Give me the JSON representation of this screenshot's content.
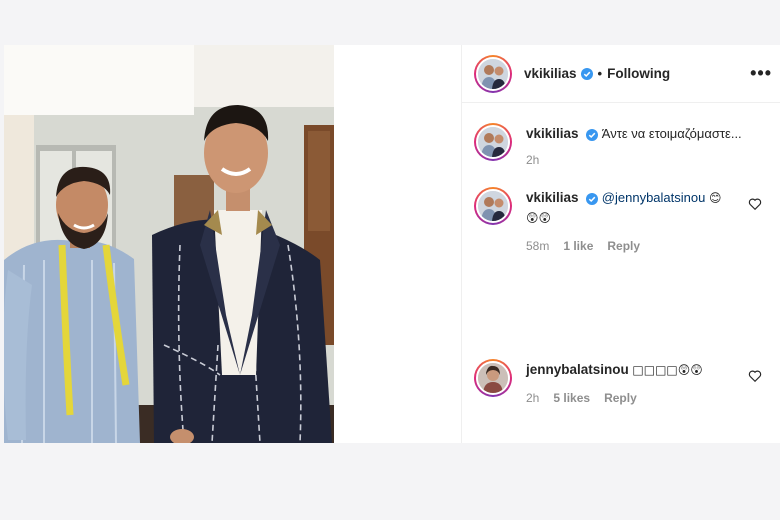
{
  "post": {
    "author": {
      "username": "vkikilias",
      "verified": true
    },
    "follow_state": "Following",
    "more_label": "•••",
    "separator": "•"
  },
  "comments": [
    {
      "username": "vkikilias",
      "verified": true,
      "text": "Άντε να ετοιμαζόμαστε...",
      "time": "2h"
    },
    {
      "username": "vkikilias",
      "verified": true,
      "mention": "@jennybalatsinou",
      "emojis_line1": "😊",
      "emojis_line2": "😲😲",
      "time": "58m",
      "likes": "1 like",
      "reply": "Reply"
    },
    {
      "username": "jennybalatsinou",
      "verified": false,
      "text": "□□□□😲😲",
      "time": "2h",
      "likes": "5 likes",
      "reply": "Reply"
    }
  ],
  "colors": {
    "verified_badge": "#3897f0",
    "secondary_text": "#8e8e8e",
    "mention": "#003569"
  }
}
